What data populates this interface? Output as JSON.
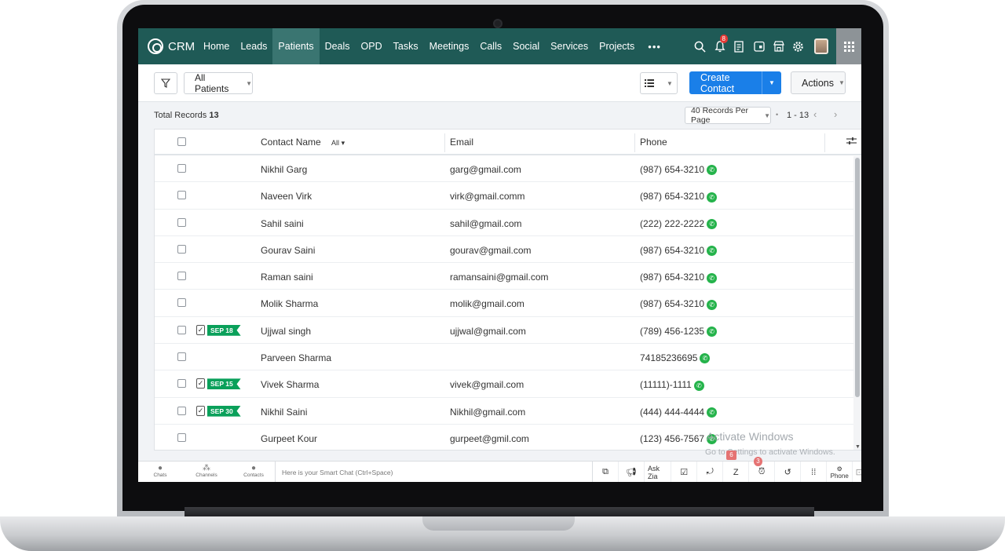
{
  "app": {
    "logo_text": "CRM",
    "accent_color": "#1f5a56",
    "primary_button_color": "#1a7fe8"
  },
  "nav": {
    "items": [
      {
        "label": "Home"
      },
      {
        "label": "Leads"
      },
      {
        "label": "Patients",
        "active": true
      },
      {
        "label": "Deals"
      },
      {
        "label": "OPD"
      },
      {
        "label": "Tasks"
      },
      {
        "label": "Meetings"
      },
      {
        "label": "Calls"
      },
      {
        "label": "Social"
      },
      {
        "label": "Services"
      },
      {
        "label": "Projects"
      }
    ],
    "more_label": "•••",
    "notification_count": "8",
    "icons": [
      "search-icon",
      "bell-icon",
      "new-record-icon",
      "calendar-icon",
      "marketplace-icon",
      "gear-icon",
      "avatar",
      "apps-grid-icon"
    ]
  },
  "toolbar": {
    "view_label": "All Patients",
    "create_label": "Create Contact",
    "actions_label": "Actions"
  },
  "records": {
    "total_label": "Total Records",
    "total_count": "13",
    "per_page": "40 Records Per Page",
    "range": "1 - 13"
  },
  "table": {
    "headers": {
      "name": "Contact Name",
      "name_filter": "All",
      "email": "Email",
      "phone": "Phone"
    },
    "rows": [
      {
        "name": "Nikhil Garg",
        "email": "garg@gmail.com",
        "phone": "(987) 654-3210",
        "tag": ""
      },
      {
        "name": "Naveen Virk",
        "email": "virk@gmail.comm",
        "phone": "(987) 654-3210",
        "tag": ""
      },
      {
        "name": "Sahil saini",
        "email": "sahil@gmail.com",
        "phone": "(222) 222-2222",
        "tag": ""
      },
      {
        "name": "Gourav Saini",
        "email": "gourav@gmail.com",
        "phone": "(987) 654-3210",
        "tag": ""
      },
      {
        "name": "Raman saini",
        "email": "ramansaini@gmail.com",
        "phone": "(987) 654-3210",
        "tag": ""
      },
      {
        "name": "Molik Sharma",
        "email": "molik@gmail.com",
        "phone": "(987) 654-3210",
        "tag": ""
      },
      {
        "name": "Ujjwal singh",
        "email": "ujjwal@gmail.com",
        "phone": "(789) 456-1235",
        "tag": "SEP 18"
      },
      {
        "name": "Parveen Sharma",
        "email": "",
        "phone": "74185236695",
        "tag": ""
      },
      {
        "name": "Vivek Sharma",
        "email": "vivek@gmail.com",
        "phone": "(11111)-1111",
        "tag": "SEP 15"
      },
      {
        "name": "Nikhil Saini",
        "email": "Nikhil@gmail.com",
        "phone": "(444) 444-4444",
        "tag": "SEP 30"
      },
      {
        "name": "Gurpeet Kour",
        "email": "gurpeet@gmil.com",
        "phone": "(123) 456-7567",
        "tag": ""
      }
    ]
  },
  "watermark": {
    "title": "Activate Windows",
    "subtitle": "Go to Settings to activate Windows."
  },
  "bottombar": {
    "tabs": [
      {
        "label": "Chats"
      },
      {
        "label": "Channels"
      },
      {
        "label": "Contacts"
      }
    ],
    "smartchat_placeholder": "Here is your Smart Chat (Ctrl+Space)",
    "ask_zia": "Ask Zia",
    "phone_label": "Phone",
    "badge_a": "6",
    "badge_b": "3"
  }
}
